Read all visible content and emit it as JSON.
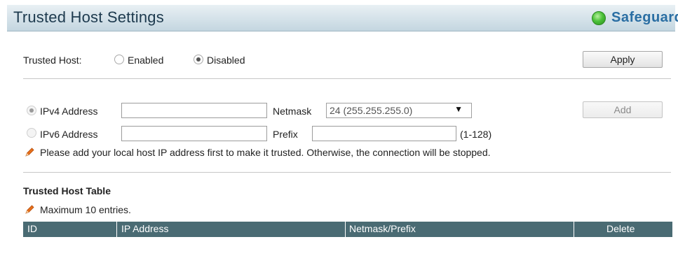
{
  "header": {
    "title": "Trusted Host Settings",
    "safeguard_label": "Safeguard",
    "safeguard_color": "#4cc23a"
  },
  "trusted_host": {
    "label": "Trusted Host:",
    "options": [
      {
        "label": "Enabled",
        "checked": false
      },
      {
        "label": "Disabled",
        "checked": true
      }
    ],
    "apply_label": "Apply"
  },
  "address_form": {
    "ipv4": {
      "label": "IPv4 Address",
      "checked": true,
      "value": ""
    },
    "ipv6": {
      "label": "IPv6 Address",
      "checked": false,
      "value": ""
    },
    "netmask": {
      "label": "Netmask",
      "selected": "24 (255.255.255.0)",
      "arrow": "▼"
    },
    "prefix": {
      "label": "Prefix",
      "value": "",
      "hint": "(1-128)"
    },
    "add_label": "Add",
    "note": "Please add your local host IP address first to make it trusted. Otherwise, the connection will be stopped."
  },
  "table": {
    "title": "Trusted Host Table",
    "note": "Maximum 10 entries.",
    "columns": [
      "ID",
      "IP Address",
      "Netmask/Prefix",
      "Delete"
    ]
  },
  "icons": {
    "pencil": "pencil-icon",
    "status": "status-dot-icon"
  }
}
